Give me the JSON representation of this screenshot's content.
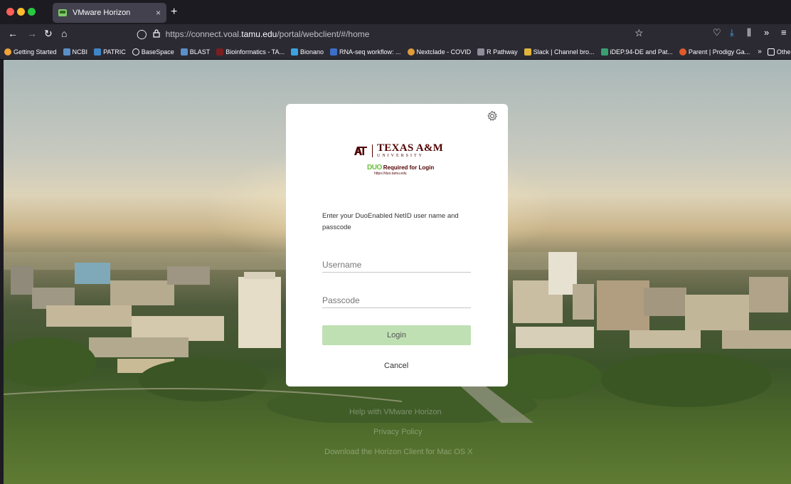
{
  "browser": {
    "tab_title": "VMware Horizon",
    "tab_close": "×",
    "new_tab": "+",
    "url_prefix": "https://connect.voal.",
    "url_domain": "tamu.edu",
    "url_path": "/portal/webclient/#/home"
  },
  "bookmarks": [
    {
      "label": "Getting Started",
      "color": "#f2a33a"
    },
    {
      "label": "NCBI",
      "color": "#5a8fc7"
    },
    {
      "label": "PATRIC",
      "color": "#3f86c9"
    },
    {
      "label": "BaseSpace",
      "color": "#9aa0a6"
    },
    {
      "label": "BLAST",
      "color": "#5a8fc7"
    },
    {
      "label": "Bioinformatics - TA...",
      "color": "#7a1f1f"
    },
    {
      "label": "Bionano",
      "color": "#3ba3e0"
    },
    {
      "label": "RNA-seq workflow: ...",
      "color": "#3b6fc9"
    },
    {
      "label": "Nextclade - COVID",
      "color": "#e39b3a"
    },
    {
      "label": "R Pathway",
      "color": "#8e8e9b"
    },
    {
      "label": "Slack | Channel bro...",
      "color": "#e0b43a"
    },
    {
      "label": "iDEP.94-DE and Pat...",
      "color": "#3aa070"
    },
    {
      "label": "Parent | Prodigy Ga...",
      "color": "#e05a2a"
    }
  ],
  "bookmarks_overflow": "»",
  "other_bookmarks": "Other Bookmarks",
  "login": {
    "university_name": "TEXAS A&M",
    "university_sub": "UNIVERSITY",
    "duo_logo": "DUO",
    "duo_required": "Required for Login",
    "duo_url": "https://duo.tamu.edu",
    "instructions": "Enter your DuoEnabled NetID user name and passcode",
    "username_placeholder": "Username",
    "passcode_placeholder": "Passcode",
    "login_label": "Login",
    "cancel_label": "Cancel"
  },
  "footer": {
    "help": "Help with VMware Horizon",
    "privacy": "Privacy Policy",
    "download": "Download the Horizon Client for Mac OS X"
  }
}
